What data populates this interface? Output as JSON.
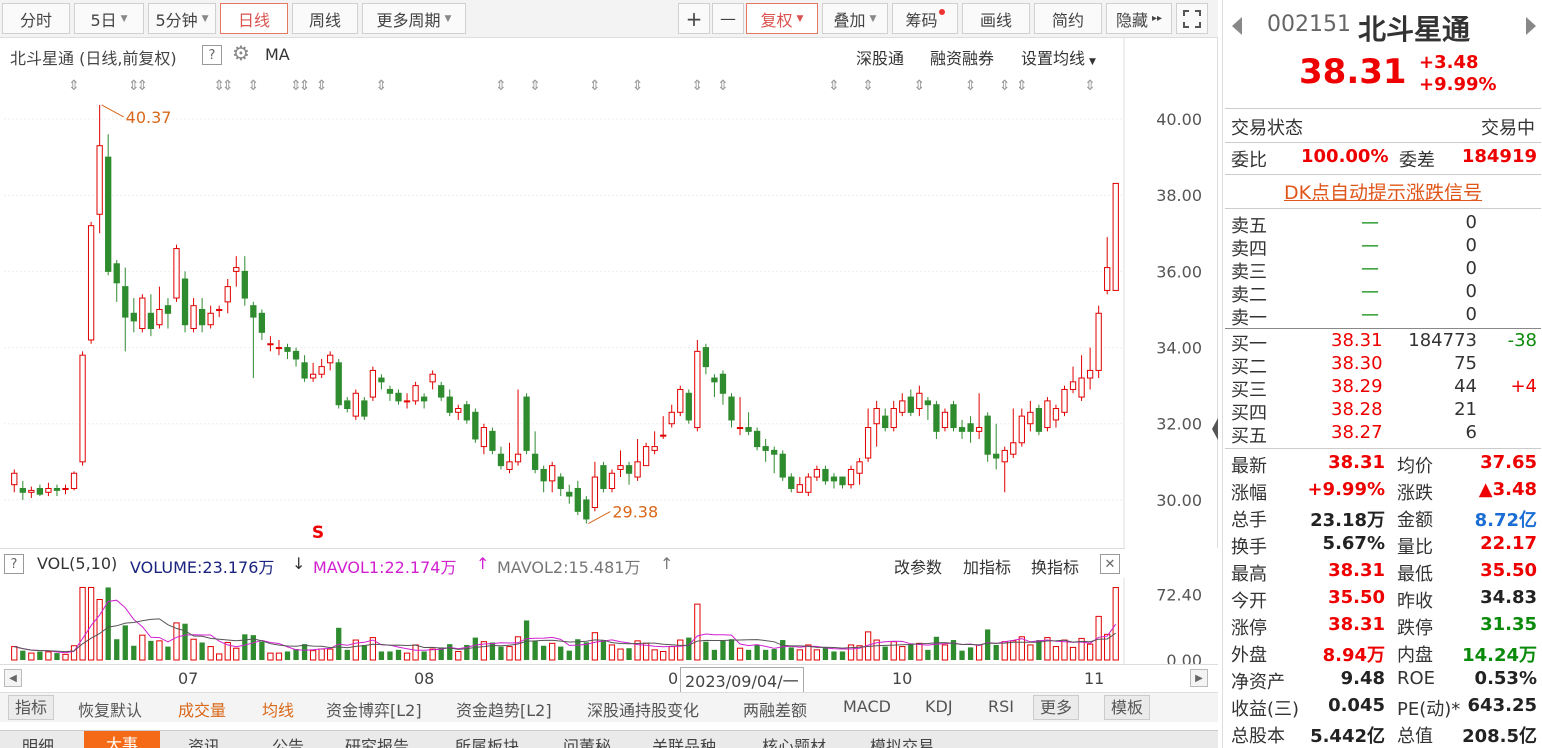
{
  "toolbar": {
    "periods": [
      "分时",
      "5日",
      "5分钟",
      "日线",
      "周线",
      "更多周期"
    ],
    "active_period": "日线",
    "buttons": [
      "+",
      "—",
      "复权",
      "叠加",
      "筹码",
      "画线",
      "简约",
      "隐藏"
    ],
    "more_arrow": "▸▸"
  },
  "chart_header": {
    "title": "北斗星通 (日线,前复权)",
    "ma_label": "MA",
    "links": [
      "深股通",
      "融资融券",
      "设置均线"
    ]
  },
  "chart_data": {
    "type": "candlestick",
    "y_ticks": [
      "40.00",
      "38.00",
      "36.00",
      "34.00",
      "32.00",
      "30.00"
    ],
    "y_range": [
      29.0,
      40.5
    ],
    "annotations": [
      {
        "label": "40.37",
        "value": 40.37
      },
      {
        "label": "29.38",
        "value": 29.38
      }
    ],
    "candles": [
      [
        30.4,
        30.7,
        30.2,
        30.8
      ],
      [
        30.3,
        30.2,
        30.0,
        30.5
      ],
      [
        30.2,
        30.25,
        30.05,
        30.35
      ],
      [
        30.3,
        30.15,
        30.1,
        30.4
      ],
      [
        30.2,
        30.3,
        30.1,
        30.45
      ],
      [
        30.3,
        30.25,
        30.1,
        30.4
      ],
      [
        30.3,
        30.3,
        30.15,
        30.4
      ],
      [
        30.3,
        30.7,
        30.25,
        30.75
      ],
      [
        31.0,
        33.8,
        30.9,
        33.9
      ],
      [
        34.2,
        37.2,
        34.1,
        37.3
      ],
      [
        37.5,
        39.3,
        37.0,
        40.37
      ],
      [
        39.0,
        36.0,
        35.9,
        39.6
      ],
      [
        36.2,
        35.7,
        35.2,
        36.3
      ],
      [
        35.6,
        34.8,
        33.9,
        36.1
      ],
      [
        34.9,
        34.7,
        34.4,
        35.3
      ],
      [
        34.5,
        35.3,
        34.4,
        35.4
      ],
      [
        34.9,
        34.5,
        34.3,
        35.4
      ],
      [
        34.6,
        35.0,
        34.5,
        35.6
      ],
      [
        35.1,
        34.9,
        34.5,
        35.3
      ],
      [
        35.3,
        36.6,
        35.2,
        36.7
      ],
      [
        35.8,
        34.6,
        34.4,
        36.0
      ],
      [
        34.5,
        35.1,
        34.4,
        35.3
      ],
      [
        35.0,
        34.6,
        34.4,
        35.3
      ],
      [
        34.6,
        34.9,
        34.5,
        35.1
      ],
      [
        35.0,
        35.0,
        34.8,
        35.1
      ],
      [
        35.2,
        35.6,
        34.9,
        35.8
      ],
      [
        36.0,
        36.1,
        35.6,
        36.4
      ],
      [
        36.0,
        35.3,
        35.1,
        36.4
      ],
      [
        35.1,
        34.8,
        33.2,
        35.2
      ],
      [
        34.9,
        34.4,
        34.2,
        35.0
      ],
      [
        34.1,
        34.1,
        33.9,
        34.3
      ],
      [
        34.0,
        34.0,
        33.8,
        34.2
      ],
      [
        34.0,
        33.9,
        33.7,
        34.1
      ],
      [
        33.9,
        33.7,
        33.5,
        34.0
      ],
      [
        33.6,
        33.2,
        33.1,
        33.8
      ],
      [
        33.2,
        33.3,
        33.1,
        33.6
      ],
      [
        33.3,
        33.5,
        33.2,
        33.7
      ],
      [
        33.6,
        33.8,
        33.4,
        33.9
      ],
      [
        33.6,
        32.5,
        32.4,
        33.7
      ],
      [
        32.6,
        32.4,
        32.3,
        32.7
      ],
      [
        32.2,
        32.8,
        32.1,
        32.9
      ],
      [
        32.6,
        32.2,
        32.1,
        32.7
      ],
      [
        32.7,
        33.4,
        32.6,
        33.5
      ],
      [
        33.2,
        33.1,
        32.9,
        33.3
      ],
      [
        32.9,
        32.8,
        32.6,
        33.0
      ],
      [
        32.8,
        32.6,
        32.5,
        32.9
      ],
      [
        32.6,
        32.6,
        32.4,
        32.8
      ],
      [
        32.6,
        33.0,
        32.5,
        33.1
      ],
      [
        32.7,
        32.6,
        32.4,
        32.8
      ],
      [
        33.1,
        33.3,
        32.9,
        33.4
      ],
      [
        33.0,
        32.7,
        32.6,
        33.1
      ],
      [
        32.7,
        32.3,
        32.2,
        32.9
      ],
      [
        32.3,
        32.4,
        32.1,
        32.5
      ],
      [
        32.5,
        32.1,
        32.0,
        32.6
      ],
      [
        32.3,
        31.6,
        31.5,
        32.4
      ],
      [
        31.4,
        31.9,
        31.2,
        32.0
      ],
      [
        31.8,
        31.3,
        31.2,
        31.9
      ],
      [
        31.2,
        30.9,
        30.8,
        31.4
      ],
      [
        30.8,
        31.0,
        30.7,
        31.5
      ],
      [
        31.0,
        31.2,
        30.9,
        32.9
      ],
      [
        32.7,
        31.3,
        31.2,
        32.8
      ],
      [
        31.2,
        30.8,
        30.7,
        31.8
      ],
      [
        30.8,
        30.5,
        30.2,
        30.9
      ],
      [
        30.5,
        30.9,
        30.2,
        31.0
      ],
      [
        30.6,
        30.3,
        30.1,
        30.7
      ],
      [
        30.2,
        30.1,
        29.9,
        30.4
      ],
      [
        30.3,
        29.7,
        29.6,
        30.5
      ],
      [
        30.0,
        29.5,
        29.38,
        30.1
      ],
      [
        29.8,
        30.6,
        29.7,
        31.0
      ],
      [
        30.9,
        30.3,
        30.2,
        31.0
      ],
      [
        30.3,
        30.7,
        30.2,
        30.8
      ],
      [
        30.8,
        30.9,
        30.6,
        31.3
      ],
      [
        30.9,
        30.7,
        30.4,
        31.0
      ],
      [
        30.6,
        31.0,
        30.5,
        31.6
      ],
      [
        30.9,
        31.4,
        30.9,
        31.5
      ],
      [
        31.3,
        31.4,
        31.2,
        31.8
      ],
      [
        31.7,
        31.7,
        31.6,
        32.2
      ],
      [
        32.0,
        32.3,
        31.9,
        32.5
      ],
      [
        32.3,
        32.9,
        32.2,
        33.0
      ],
      [
        32.8,
        32.1,
        32.0,
        32.9
      ],
      [
        31.9,
        33.9,
        31.8,
        34.2
      ],
      [
        34.0,
        33.5,
        33.3,
        34.1
      ],
      [
        33.2,
        33.1,
        32.7,
        33.3
      ],
      [
        33.3,
        32.8,
        32.5,
        33.4
      ],
      [
        32.7,
        32.1,
        31.9,
        32.8
      ],
      [
        31.9,
        31.9,
        31.7,
        32.7
      ],
      [
        31.9,
        31.8,
        31.7,
        32.3
      ],
      [
        31.8,
        31.4,
        31.3,
        31.9
      ],
      [
        31.4,
        31.3,
        31.0,
        31.6
      ],
      [
        31.3,
        31.2,
        30.7,
        31.4
      ],
      [
        31.2,
        30.6,
        30.5,
        31.3
      ],
      [
        30.6,
        30.3,
        30.2,
        30.7
      ],
      [
        30.2,
        30.4,
        30.2,
        30.6
      ],
      [
        30.2,
        30.6,
        30.1,
        30.7
      ],
      [
        30.6,
        30.8,
        30.5,
        30.9
      ],
      [
        30.8,
        30.5,
        30.4,
        30.9
      ],
      [
        30.6,
        30.5,
        30.3,
        30.7
      ],
      [
        30.6,
        30.4,
        30.3,
        30.5
      ],
      [
        30.4,
        30.8,
        30.3,
        30.9
      ],
      [
        30.7,
        31.0,
        30.4,
        31.1
      ],
      [
        31.1,
        31.9,
        31.0,
        32.4
      ],
      [
        32.0,
        32.4,
        31.4,
        32.6
      ],
      [
        32.2,
        31.9,
        31.8,
        32.4
      ],
      [
        31.9,
        32.4,
        31.8,
        32.6
      ],
      [
        32.3,
        32.6,
        32.2,
        32.8
      ],
      [
        32.7,
        32.3,
        32.2,
        32.9
      ],
      [
        32.4,
        32.8,
        32.2,
        33.0
      ],
      [
        32.6,
        32.5,
        32.1,
        32.7
      ],
      [
        32.5,
        31.8,
        31.6,
        32.6
      ],
      [
        31.9,
        32.3,
        31.8,
        32.4
      ],
      [
        32.5,
        31.9,
        31.8,
        32.6
      ],
      [
        31.9,
        31.8,
        31.6,
        32.1
      ],
      [
        32.0,
        31.8,
        31.5,
        32.2
      ],
      [
        31.8,
        31.9,
        31.6,
        32.8
      ],
      [
        32.2,
        31.2,
        31.0,
        32.3
      ],
      [
        31.2,
        31.1,
        30.8,
        32.0
      ],
      [
        31.0,
        31.3,
        30.2,
        31.4
      ],
      [
        31.2,
        31.5,
        31.1,
        32.4
      ],
      [
        31.5,
        32.2,
        31.4,
        32.4
      ],
      [
        32.0,
        32.3,
        31.8,
        32.6
      ],
      [
        32.4,
        31.8,
        31.7,
        32.5
      ],
      [
        31.9,
        32.6,
        31.8,
        32.7
      ],
      [
        32.1,
        32.4,
        31.9,
        32.5
      ],
      [
        32.3,
        32.9,
        32.2,
        33.0
      ],
      [
        32.9,
        33.1,
        32.8,
        33.5
      ],
      [
        32.7,
        33.2,
        32.6,
        33.8
      ],
      [
        33.2,
        33.4,
        32.9,
        34.0
      ],
      [
        33.4,
        34.9,
        33.2,
        35.1
      ],
      [
        35.5,
        36.1,
        35.4,
        36.9
      ],
      [
        35.5,
        38.31,
        35.5,
        38.31
      ]
    ],
    "vol_ticks": [
      "72.40",
      "0.00"
    ],
    "vol_range": [
      0,
      86
    ]
  },
  "vol_header": {
    "name": "VOL(5,10)",
    "volume": "VOLUME:23.176万",
    "mavol1": "MAVOL1:22.174万",
    "mavol2": "MAVOL2:15.481万",
    "links": [
      "改参数",
      "加指标",
      "换指标"
    ],
    "down_arrow": "↓",
    "up_arrow": "↑"
  },
  "datebar": {
    "labels": [
      "07",
      "08",
      "0",
      "10",
      "11"
    ],
    "cursor_date": "2023/09/04/一"
  },
  "indicator_tabs": [
    "指标",
    "恢复默认",
    "成交量",
    "均线",
    "资金博弈[L2]",
    "资金趋势[L2]",
    "深股通持股变化",
    "两融差额",
    "MACD",
    "KDJ",
    "RSI",
    "更多",
    "模板"
  ],
  "bottom_tabs": [
    "明细",
    "大事",
    "资讯",
    "公告",
    "研究报告",
    "所属板块",
    "问董秘",
    "关联品种",
    "核心题材",
    "模拟交易"
  ],
  "signal_marker": "S",
  "quote": {
    "code": "002151",
    "name": "北斗星通",
    "price": "38.31",
    "change": "+3.48",
    "change_pct": "+9.99%",
    "status_label": "交易状态",
    "status_value": "交易中",
    "weibi_label": "委比",
    "weibi_value": "100.00%",
    "weicha_label": "委差",
    "weicha_value": "184919",
    "dk_banner": "DK点自动提示涨跌信号",
    "asks": [
      {
        "label": "卖五",
        "price": "—",
        "volume": "0"
      },
      {
        "label": "卖四",
        "price": "—",
        "volume": "0"
      },
      {
        "label": "卖三",
        "price": "—",
        "volume": "0"
      },
      {
        "label": "卖二",
        "price": "—",
        "volume": "0"
      },
      {
        "label": "卖一",
        "price": "—",
        "volume": "0"
      }
    ],
    "bids": [
      {
        "label": "买一",
        "price": "38.31",
        "volume": "184773",
        "delta": "-38"
      },
      {
        "label": "买二",
        "price": "38.30",
        "volume": "75",
        "delta": ""
      },
      {
        "label": "买三",
        "price": "38.29",
        "volume": "44",
        "delta": "+4"
      },
      {
        "label": "买四",
        "price": "38.28",
        "volume": "21",
        "delta": ""
      },
      {
        "label": "买五",
        "price": "38.27",
        "volume": "6",
        "delta": ""
      }
    ],
    "stats": [
      {
        "l1": "最新",
        "v1": "38.31",
        "c1": "red",
        "l2": "均价",
        "v2": "37.65",
        "c2": "red"
      },
      {
        "l1": "涨幅",
        "v1": "+9.99%",
        "c1": "red",
        "l2": "涨跌",
        "v2": "▲3.48",
        "c2": "red"
      },
      {
        "l1": "总手",
        "v1": "23.18万",
        "c1": "",
        "l2": "金额",
        "v2": "8.72亿",
        "c2": "blue"
      },
      {
        "l1": "换手",
        "v1": "5.67%",
        "c1": "",
        "l2": "量比",
        "v2": "22.17",
        "c2": "red"
      },
      {
        "l1": "最高",
        "v1": "38.31",
        "c1": "red",
        "l2": "最低",
        "v2": "35.50",
        "c2": "red"
      },
      {
        "l1": "今开",
        "v1": "35.50",
        "c1": "red",
        "l2": "昨收",
        "v2": "34.83",
        "c2": ""
      },
      {
        "l1": "涨停",
        "v1": "38.31",
        "c1": "red",
        "l2": "跌停",
        "v2": "31.35",
        "c2": "green"
      },
      {
        "l1": "外盘",
        "v1": "8.94万",
        "c1": "red",
        "l2": "内盘",
        "v2": "14.24万",
        "c2": "green"
      },
      {
        "l1": "净资产",
        "v1": "9.48",
        "c1": "",
        "l2": "ROE",
        "v2": "0.53%",
        "c2": ""
      },
      {
        "l1": "收益(三)",
        "v1": "0.045",
        "c1": "",
        "l2": "PE(动)*",
        "v2": "643.25",
        "c2": ""
      },
      {
        "l1": "总股本",
        "v1": "5.442亿",
        "c1": "",
        "l2": "总值",
        "v2": "208.5亿",
        "c2": ""
      }
    ]
  },
  "colors": {
    "up": "#e00000",
    "down": "#2e8b2e",
    "accent": "#f56a16",
    "ma1": "#d020d0",
    "ma2": "#555555"
  }
}
